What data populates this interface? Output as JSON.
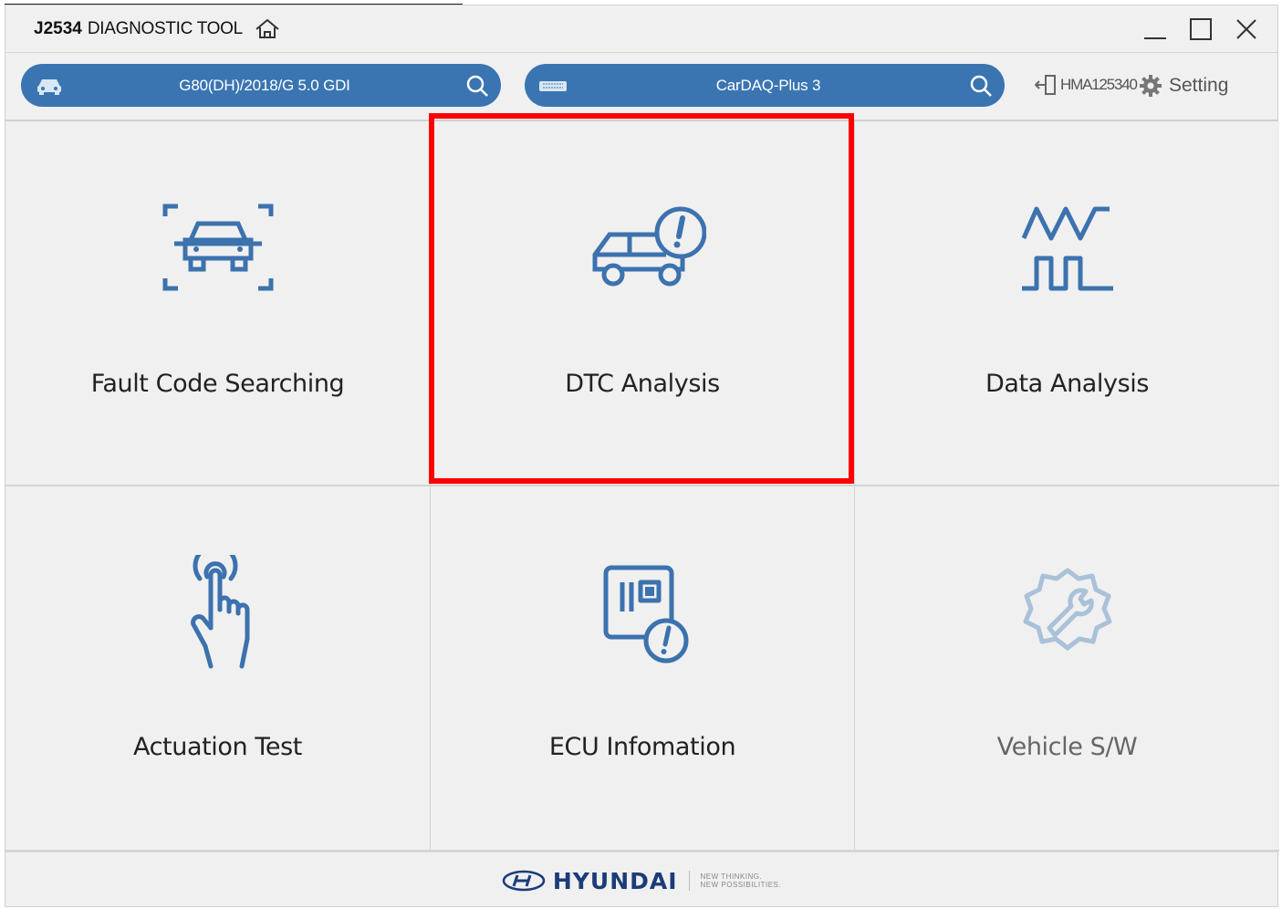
{
  "window": {
    "title_bold": "J2534",
    "title_rest": "DIAGNOSTIC TOOL",
    "home_icon": "home-icon",
    "controls": [
      "minimize",
      "maximize",
      "close"
    ]
  },
  "toolbar": {
    "vehicle": {
      "text": "G80(DH)/2018/G 5.0 GDI",
      "icon": "car-icon"
    },
    "device": {
      "text": "CarDAQ-Plus 3",
      "icon": "interface-device-icon"
    },
    "user": {
      "text": "HMA125340",
      "icon": "logout-icon"
    },
    "setting": {
      "text": "Setting",
      "icon": "gear-icon"
    }
  },
  "tiles": [
    {
      "label": "Fault Code Searching",
      "icon": "car-scan-icon",
      "enabled": true
    },
    {
      "label": "DTC Analysis",
      "icon": "car-alert-icon",
      "enabled": true,
      "highlighted": true
    },
    {
      "label": "Data Analysis",
      "icon": "waveform-icon",
      "enabled": true
    },
    {
      "label": "Actuation Test",
      "icon": "touch-hand-icon",
      "enabled": true
    },
    {
      "label": "ECU Infomation",
      "icon": "ecu-alert-icon",
      "enabled": true
    },
    {
      "label": "Vehicle S/W",
      "icon": "gear-wrench-icon",
      "enabled": false
    }
  ],
  "footer": {
    "brand": "HYUNDAI",
    "tagline_line1": "NEW THINKING.",
    "tagline_line2": "NEW POSSIBILITIES."
  },
  "colors": {
    "accent": "#3a75b2",
    "icon_blue": "#3c72ae",
    "highlight": "#ff0000",
    "disabled_icon": "#a9c1d9",
    "brand": "#1b3c78"
  }
}
